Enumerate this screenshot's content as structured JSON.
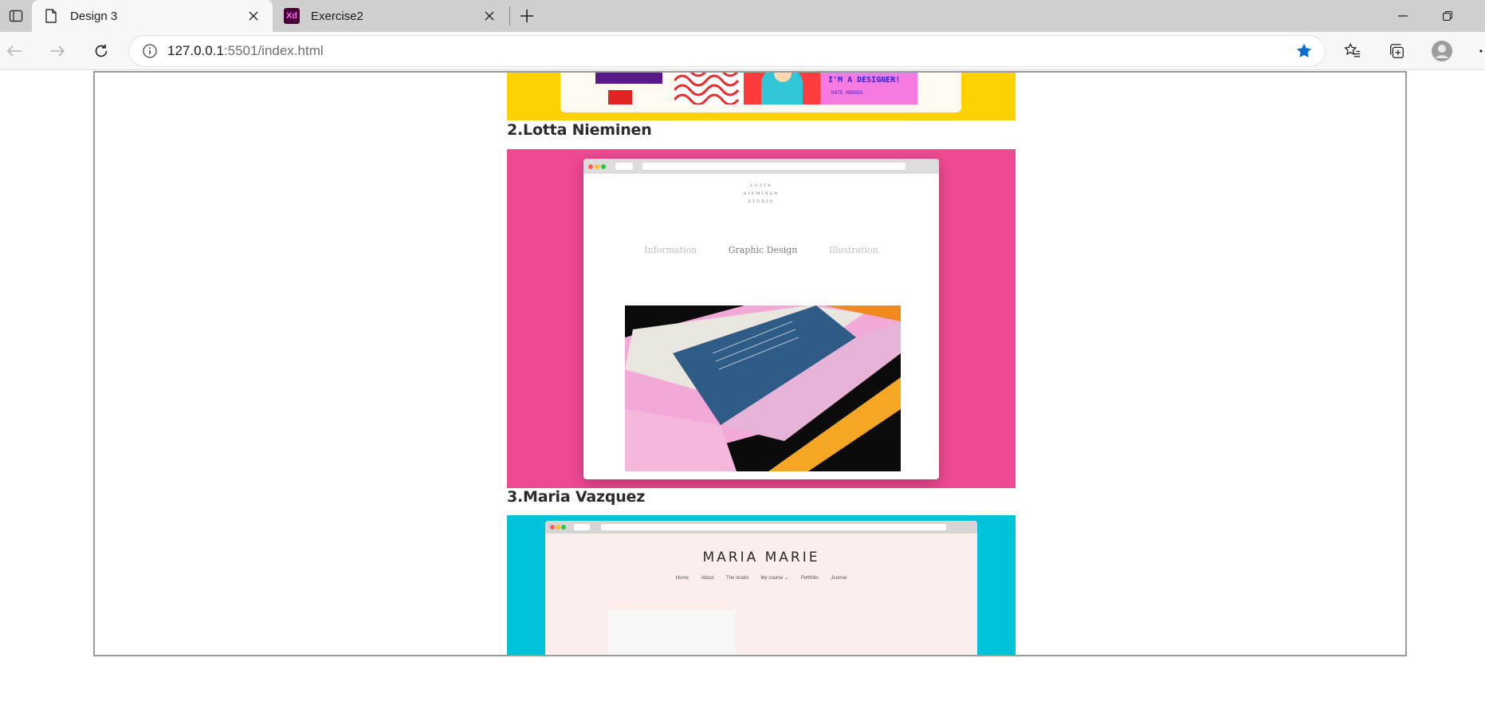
{
  "browser": {
    "tabs": [
      {
        "title": "Design 3",
        "icon": "page-icon",
        "active": true
      },
      {
        "title": "Exercise2",
        "icon": "xd-icon",
        "favicon_text": "Xd",
        "active": false
      }
    ],
    "address": {
      "host": "127.0.0.1",
      "port_path": ":5501/index.html"
    },
    "colors": {
      "accent": "#0a6ed1",
      "tabbar": "#cfcfcf",
      "toolbar": "#f7f7f7"
    }
  },
  "page": {
    "sections": [
      {
        "heading": "2.Lotta Nieminen"
      },
      {
        "heading": "3.Maria Vazquez"
      }
    ],
    "site1": {
      "sticker_text": "I'M A DESIGNER!",
      "sticker_sub": "KATE MOROSS",
      "bg": "#fed100"
    },
    "site2": {
      "bg": "#ef4992",
      "studio_lines": [
        "LOTTA",
        "NIEMINEN",
        "STUDIO"
      ],
      "menu": [
        "Information",
        "Graphic Design",
        "Illustration"
      ]
    },
    "site3": {
      "bg": "#00c3da",
      "title": "MARIA MARIE",
      "menu": [
        "Home",
        "About",
        "The studio",
        "My course ⌄",
        "Portfolio",
        "Journal"
      ]
    }
  }
}
